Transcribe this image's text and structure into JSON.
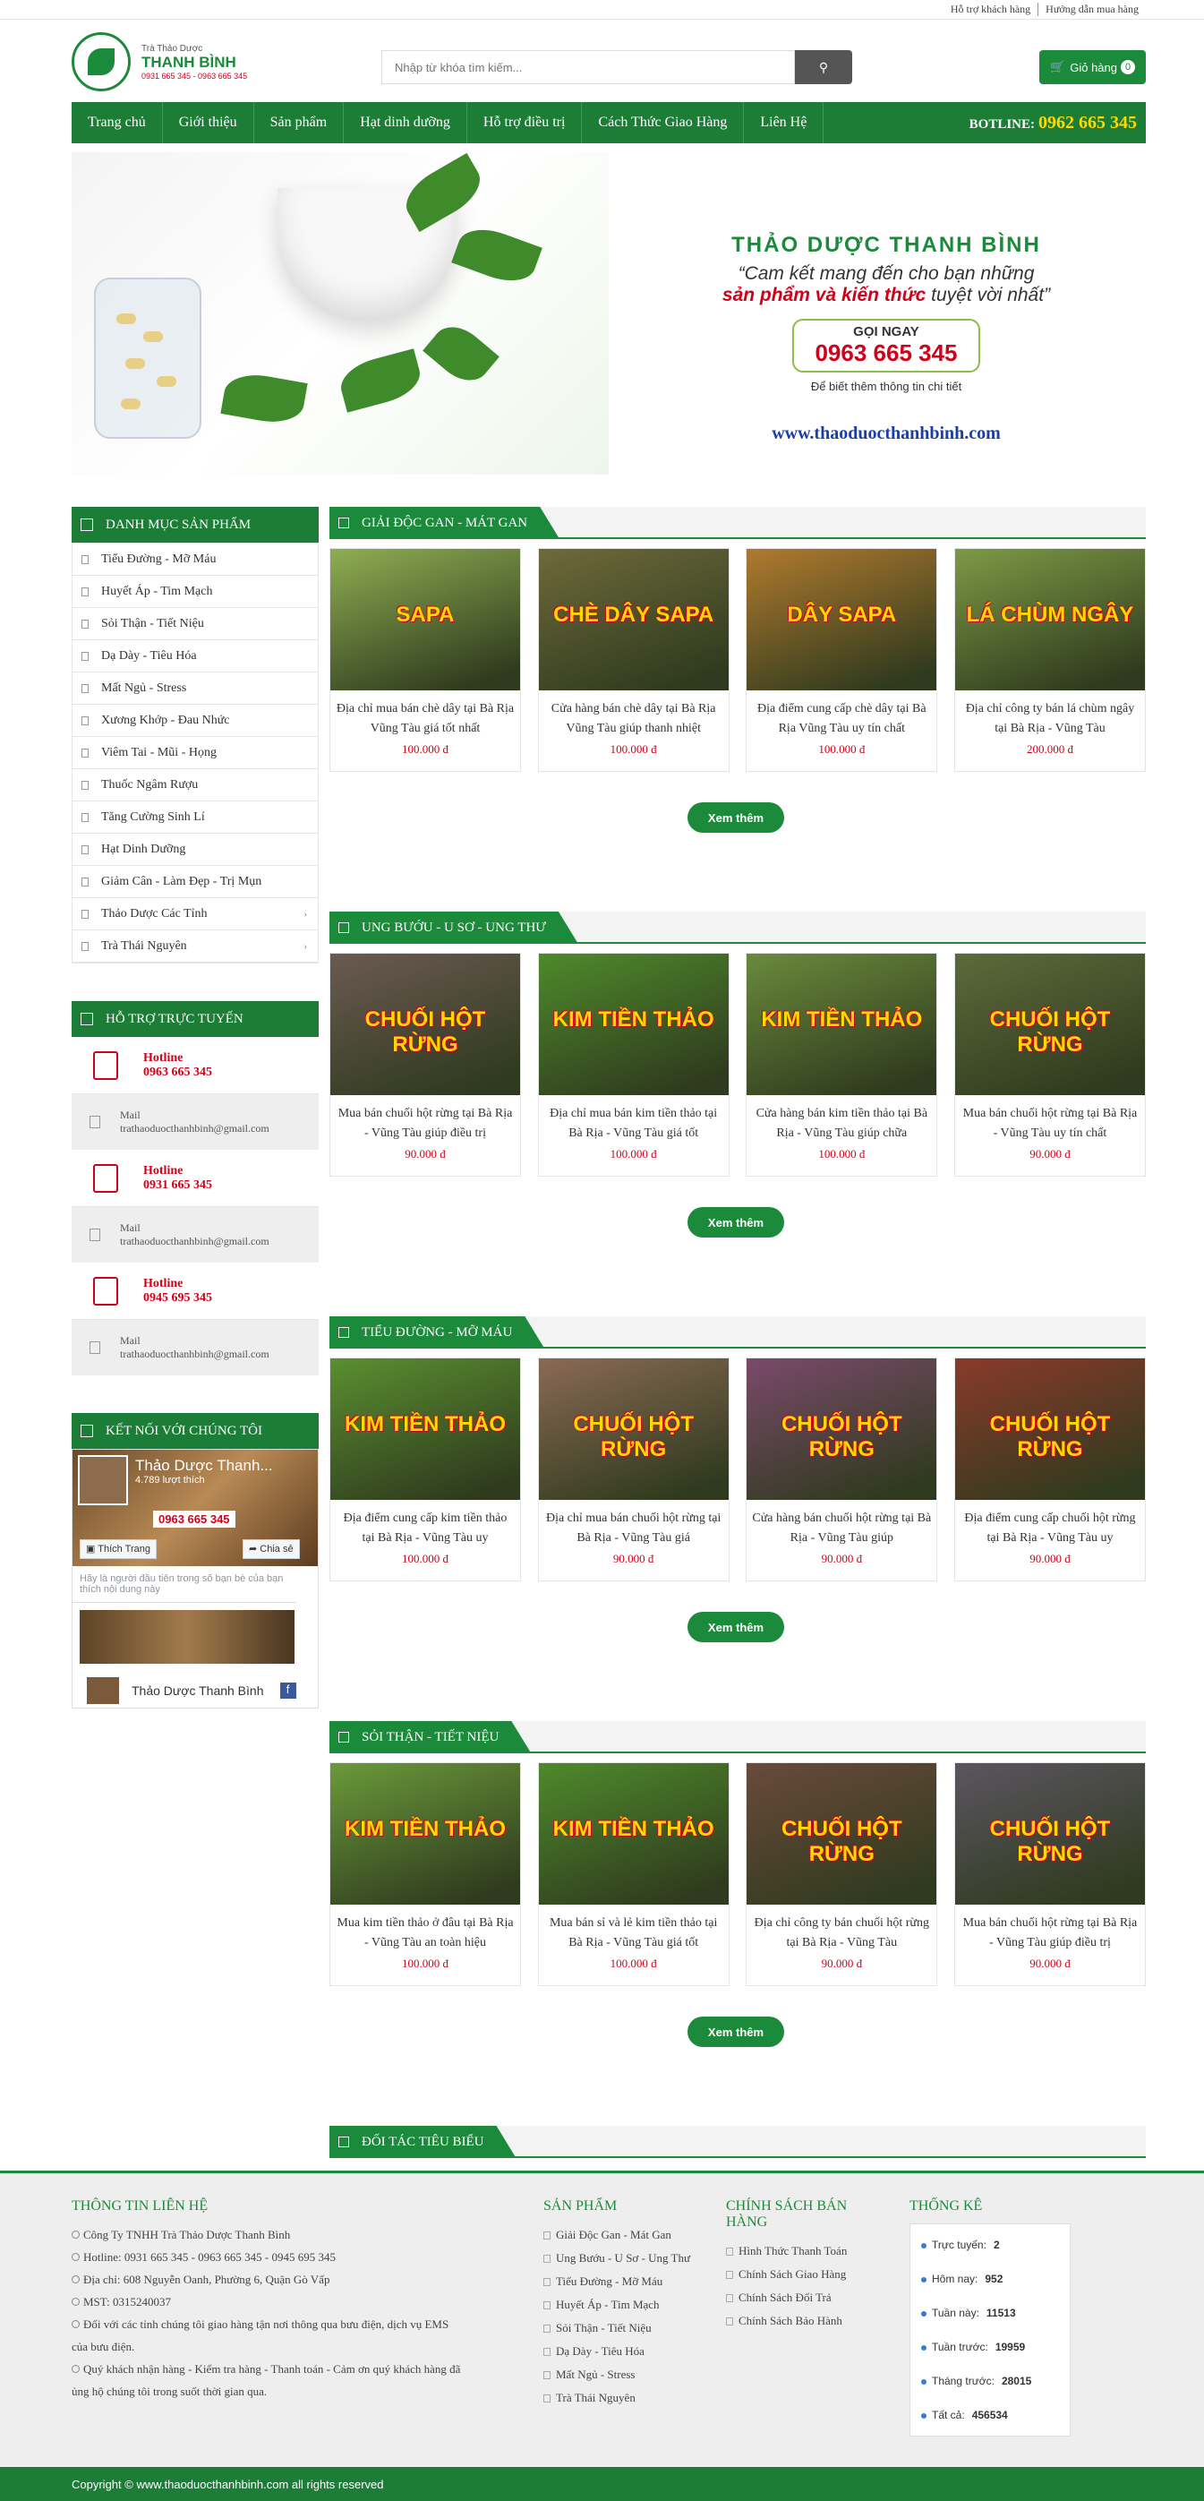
{
  "topbar": {
    "links": [
      "Hỗ trợ khách hàng",
      "Hướng dẫn mua hàng"
    ]
  },
  "logo": {
    "sub": "Trà Thảo Dược",
    "name": "THANH BÌNH",
    "phone": "0931 665 345 - 0963 665 345"
  },
  "search": {
    "placeholder": "Nhập từ khóa tìm kiếm..."
  },
  "cart": {
    "label": "Giỏ hàng",
    "count": "0"
  },
  "nav": {
    "items": [
      "Trang chủ",
      "Giới thiệu",
      "Sản phẩm",
      "Hạt dinh dưỡng",
      "Hỗ trợ điều trị",
      "Cách Thức Giao Hàng",
      "Liên Hệ"
    ],
    "hotline_label": "BOTLINE:",
    "hotline": "0962 665 345"
  },
  "banner": {
    "title": "THẢO DƯỢC THANH BÌNH",
    "quote1": "“Cam kết mang đến cho bạn những",
    "quote2_red": "sản phẩm và kiến thức",
    "quote2_rest": " tuyệt vời nhất”",
    "call_label": "GỌI NGAY",
    "call_phone": "0963 665 345",
    "more": "Để biết thêm thông tin chi tiết",
    "url": "www.thaoduocthanhbinh.com"
  },
  "categories": {
    "title": "DANH MỤC SẢN PHẨM",
    "items": [
      {
        "label": "Tiểu Đường - Mỡ Máu",
        "sub": false
      },
      {
        "label": "Huyết Áp - Tim Mạch",
        "sub": false
      },
      {
        "label": "Sỏi Thận - Tiết Niệu",
        "sub": false
      },
      {
        "label": "Dạ Dày - Tiêu Hóa",
        "sub": false
      },
      {
        "label": "Mất Ngủ - Stress",
        "sub": false
      },
      {
        "label": "Xương Khớp - Đau Nhức",
        "sub": false
      },
      {
        "label": "Viêm Tai - Mũi - Họng",
        "sub": false
      },
      {
        "label": "Thuốc Ngâm Rượu",
        "sub": false
      },
      {
        "label": "Tăng Cường Sinh Lí",
        "sub": false
      },
      {
        "label": "Hạt Dinh Dưỡng",
        "sub": false
      },
      {
        "label": "Giảm Cân - Làm Đẹp - Trị Mụn",
        "sub": false
      },
      {
        "label": "Thảo Dược Các Tỉnh",
        "sub": true
      },
      {
        "label": "Trà Thái Nguyên",
        "sub": true
      }
    ]
  },
  "support": {
    "title": "HỖ TRỢ TRỰC TUYẾN",
    "blocks": [
      {
        "hot_label": "Hotline",
        "phone": "0963 665 345",
        "mail_label": "Mail",
        "mail": "trathaoduocthanhbinh@gmail.com"
      },
      {
        "hot_label": "Hotline",
        "phone": "0931 665 345",
        "mail_label": "Mail",
        "mail": "trathaoduocthanhbinh@gmail.com"
      },
      {
        "hot_label": "Hotline",
        "phone": "0945 695 345",
        "mail_label": "Mail",
        "mail": "trathaoduocthanhbinh@gmail.com"
      }
    ]
  },
  "connect": {
    "title": "KẾT NỐI VỚI CHÚNG TÔI",
    "page_name": "Thảo Dược Thanh...",
    "likes": "4.789 lượt thích",
    "cover_phone": "0963 665 345",
    "like_btn": "Thích Trang",
    "share_btn": "Chia sẻ",
    "post": "Hãy là người đầu tiên trong số bạn bè của bạn thích nội dung này",
    "footer_name": "Thảo Dược Thanh Bình",
    "fb_letter": "f"
  },
  "sections": [
    {
      "title": "GIẢI ĐỘC GAN - MÁT GAN",
      "more": "Xem thêm",
      "products": [
        {
          "name": "Địa chỉ mua bán chè dây tại Bà Rịa Vũng Tàu giá tốt nhất",
          "price": "100.000 đ",
          "label": "SAPA",
          "bg": "#8fae52"
        },
        {
          "name": "Cửa hàng bán chè dây tại Bà Rịa Vũng Tàu giúp thanh nhiệt",
          "price": "100.000 đ",
          "label": "CHÈ DÂY SAPA",
          "bg": "#6e6a3a"
        },
        {
          "name": "Địa điểm cung cấp chè dây tại Bà Rịa Vũng Tàu uy tín chất",
          "price": "100.000 đ",
          "label": "DÂY SAPA",
          "bg": "#b07a2e"
        },
        {
          "name": "Địa chỉ công ty bán lá chùm ngây tại Bà Rịa - Vũng Tàu",
          "price": "200.000 đ",
          "label": "LÁ CHÙM NGÂY",
          "bg": "#7d9a45"
        }
      ]
    },
    {
      "title": "UNG BƯỚU - U SƠ - UNG THƯ",
      "more": "Xem thêm",
      "products": [
        {
          "name": "Mua bán chuối hột rừng tại Bà Rịa - Vũng Tàu giúp điều trị",
          "price": "90.000 đ",
          "label": "CHUỐI HỘT RỪNG",
          "bg": "#6b5a52"
        },
        {
          "name": "Địa chỉ mua bán kim tiền thảo tại Bà Rịa - Vũng Tàu giá tốt",
          "price": "100.000 đ",
          "label": "KIM TIỀN THẢO",
          "bg": "#4e8a2b"
        },
        {
          "name": "Cửa hàng bán kim tiền thảo tại Bà Rịa - Vũng Tàu giúp chữa",
          "price": "100.000 đ",
          "label": "KIM TIỀN THẢO",
          "bg": "#6a8a3c"
        },
        {
          "name": "Mua bán chuối hột rừng tại Bà Rịa - Vũng Tàu uy tín chất",
          "price": "90.000 đ",
          "label": "CHUỐI HỘT RỪNG",
          "bg": "#5c6b3a"
        }
      ]
    },
    {
      "title": "TIỂU ĐƯỜNG - MỠ MÁU",
      "more": "Xem thêm",
      "products": [
        {
          "name": "Địa điểm cung cấp kim tiền thảo tại Bà Rịa - Vũng Tàu uy",
          "price": "100.000 đ",
          "label": "KIM TIỀN THẢO",
          "bg": "#5a8f30"
        },
        {
          "name": "Địa chỉ mua bán chuối hột rừng tại Bà Rịa - Vũng Tàu giá",
          "price": "90.000 đ",
          "label": "CHUỐI HỘT RỪNG",
          "bg": "#8a6a55"
        },
        {
          "name": "Cửa hàng bán chuối hột rừng tại Bà Rịa - Vũng Tàu giúp",
          "price": "90.000 đ",
          "label": "CHUỐI HỘT RỪNG",
          "bg": "#7a4a6a"
        },
        {
          "name": "Địa điểm cung cấp chuối hột rừng tại Bà Rịa - Vũng Tàu uy",
          "price": "90.000 đ",
          "label": "CHUỐI HỘT RỪNG",
          "bg": "#8a3a2a"
        }
      ]
    },
    {
      "title": "SỎI THẬN - TIẾT NIỆU",
      "more": "Xem thêm",
      "products": [
        {
          "name": "Mua kim tiền thảo ở đâu tại Bà Rịa - Vũng Tàu an toàn hiệu",
          "price": "100.000 đ",
          "label": "KIM TIỀN THẢO",
          "bg": "#6a9a3a"
        },
        {
          "name": "Mua bán sỉ và lẻ kim tiền thảo tại Bà Rịa - Vũng Tàu giá tốt",
          "price": "100.000 đ",
          "label": "KIM TIỀN THẢO",
          "bg": "#4e8a2b"
        },
        {
          "name": "Địa chỉ công ty bán chuối hột rừng tại Bà Rịa - Vũng Tàu",
          "price": "90.000 đ",
          "label": "CHUỐI HỘT RỪNG",
          "bg": "#6a4a3a"
        },
        {
          "name": "Mua bán chuối hột rừng tại Bà Rịa - Vũng Tàu giúp điều trị",
          "price": "90.000 đ",
          "label": "CHUỐI HỘT RỪNG",
          "bg": "#5b5560"
        }
      ]
    }
  ],
  "partners": {
    "title": "ĐỐI TÁC TIÊU BIỂU"
  },
  "footer": {
    "contact": {
      "title": "THÔNG TIN LIÊN HỆ",
      "lines": [
        "Công Ty TNHH Trà Thảo Dược Thanh Bình",
        "Hotline: 0931 665 345 - 0963 665 345 - 0945 695 345",
        "Địa chỉ: 608 Nguyễn Oanh, Phường 6, Quận Gò Vấp",
        "MST: 0315240037",
        "Đối với các tỉnh chúng tôi giao hàng tận nơi thông qua bưu điện, dịch vụ EMS  của bưu điện.",
        "Quý khách nhận hàng - Kiểm tra hàng - Thanh toán - Cảm ơn quý khách hàng đã ủng hộ chúng tôi trong suốt thời gian qua."
      ]
    },
    "products": {
      "title": "SẢN PHẨM",
      "items": [
        "Giải Độc Gan - Mát Gan",
        "Ung Bướu - U Sơ - Ung Thư",
        "Tiểu Đường - Mỡ Máu",
        "Huyết Áp - Tim Mạch",
        "Sỏi Thận - Tiết Niệu",
        "Dạ Dày - Tiêu Hóa",
        "Mất Ngủ - Stress",
        "Trà Thái Nguyên"
      ]
    },
    "policy": {
      "title": "CHÍNH SÁCH BÁN HÀNG",
      "items": [
        "Hình Thức Thanh Toán",
        "Chính Sách Giao Hàng",
        "Chính Sách Đổi Trả",
        "Chính Sách Bảo Hành"
      ]
    },
    "stats": {
      "title": "THỐNG KÊ",
      "rows": [
        {
          "label": "Trực tuyến:",
          "value": "2"
        },
        {
          "label": "Hôm nay:",
          "value": "952"
        },
        {
          "label": "Tuần này:",
          "value": "11513"
        },
        {
          "label": "Tuần trước:",
          "value": "19959"
        },
        {
          "label": "Tháng trước:",
          "value": "28015"
        },
        {
          "label": "Tất cả:",
          "value": "456534"
        }
      ]
    },
    "copyright": "Copyright © www.thaoduocthanhbinh.com all rights reserved"
  },
  "colors": {
    "primary": "#1c8a3b",
    "nav": "#1c7d36",
    "price": "#d0021b",
    "hotline": "#ffd800"
  }
}
